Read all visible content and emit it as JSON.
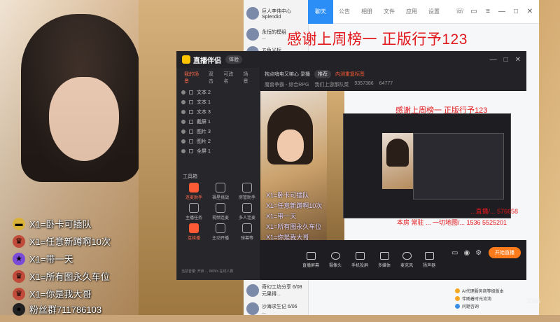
{
  "overlay": {
    "items": [
      {
        "icon": "gold-bar-icon",
        "text": "X1=卧卡可插队"
      },
      {
        "icon": "crown-icon",
        "text": "X1=任意新蹲啊10次"
      },
      {
        "icon": "star-badge-icon",
        "text": "X1=带一天"
      },
      {
        "icon": "crown-icon",
        "text": "X1=所有图永久车位"
      },
      {
        "icon": "crown-icon",
        "text": "X1=你是我大哥"
      },
      {
        "icon": "penguin-icon",
        "text": "粉丝群711786103"
      }
    ]
  },
  "chat_list": {
    "items": [
      {
        "name": "巨人李伟中心",
        "sub": "Splendid"
      },
      {
        "name": "永恒的模组",
        "sub": "..."
      },
      {
        "name": "五色光标",
        "sub": "..."
      }
    ],
    "bottom_items": [
      {
        "name": "奇幻工坊分享",
        "sub": "元果得...",
        "time": "6/08"
      },
      {
        "name": "沙海求生记",
        "sub": "...",
        "time": "6/06"
      }
    ]
  },
  "qq": {
    "tabs": [
      "聊天",
      "公告",
      "相册",
      "文件",
      "应用",
      "设置"
    ],
    "bottom": [
      "A/代理服务商等级版本",
      "伴随着时光流淌",
      "问题咨询",
      "好游戏分享"
    ]
  },
  "banner": {
    "text": "感谢上周榜一 正版行予123"
  },
  "app": {
    "name": "直播伴侣",
    "badge": "体验",
    "controls": [
      "—",
      "□",
      "✕"
    ],
    "scene_tabs": [
      "我的场景",
      "双击",
      "可改名",
      "场景"
    ],
    "scenes": [
      "文本 2",
      "文本 1",
      "文本 3",
      "截屏 1",
      "图片 3",
      "图片 2",
      "全屏 1"
    ],
    "tools_title": "工具箱",
    "tools": [
      {
        "label": "连麦助手",
        "hot": true
      },
      {
        "label": "福星挑战",
        "hot": false
      },
      {
        "label": "房管助手",
        "hot": false
      },
      {
        "label": "主播任务",
        "hot": false
      },
      {
        "label": "视频连麦",
        "hot": false
      },
      {
        "label": "多人连麦",
        "hot": false
      },
      {
        "label": "连续播",
        "hot": true
      },
      {
        "label": "主动开播",
        "hot": false
      },
      {
        "label": "弹幕等",
        "hot": false
      }
    ],
    "status_text": "当前音量: 开启 ... 6KB/s 在线人数",
    "stream_title": "抱点嗨电又嘛心 录播",
    "stream_tag": "推荐",
    "stream_sub": "内测重复标签",
    "info_items": [
      "魔兽争霸 - 综合RPG",
      "我们上游那队菜",
      "9357386",
      "64777"
    ]
  },
  "preview": {
    "red_text": "感谢上周榜一 正版行予123",
    "red_lines": [
      "...直播/... 576658",
      "本房 常驻 ... 一切地图/... 1536 5525201"
    ],
    "overlay_lines": [
      "X1=卧卡可插队",
      "X1=任意新蹲啊10次",
      "X1=带一天",
      "X1=所有图永久车位",
      "X1=你是我大哥"
    ]
  },
  "bottombar": {
    "items": [
      {
        "icon": "screen-icon",
        "label": "直播屏幕"
      },
      {
        "icon": "camera-icon",
        "label": "摄像头"
      },
      {
        "icon": "phone-icon",
        "label": "手机投屏"
      },
      {
        "icon": "media-icon",
        "label": "多媒体"
      },
      {
        "icon": "mic-icon",
        "label": "麦克风"
      },
      {
        "icon": "speaker-icon",
        "label": "扬声器"
      }
    ],
    "start_label": "开始直播"
  },
  "watermark": "3386"
}
